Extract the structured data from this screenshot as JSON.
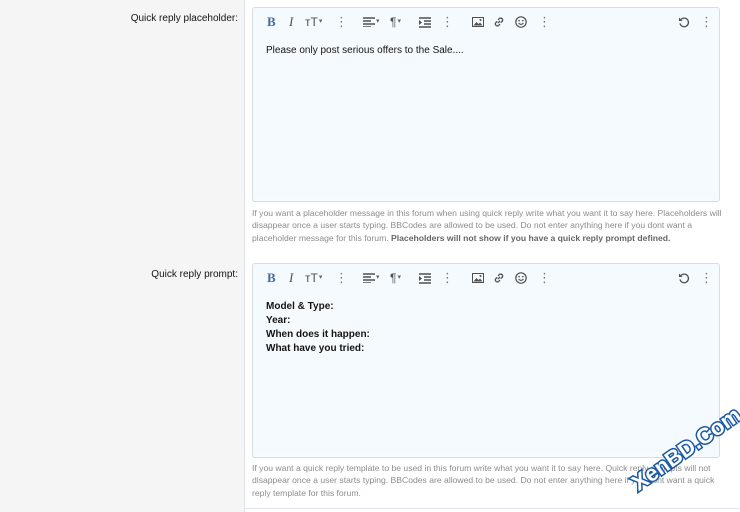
{
  "fields": [
    {
      "label": "Quick reply placeholder:",
      "content_lines": [
        "Please only post serious offers to the Sale...."
      ],
      "explain_text": "If you want a placeholder message in this forum when using quick reply write what you want it to say here. Placeholders will disappear once a user starts typing. BBCodes are allowed to be used. Do not enter anything here if you dont want a placeholder message for this forum.",
      "explain_strong": "Placeholders will not show if you have a quick reply prompt defined."
    },
    {
      "label": "Quick reply prompt:",
      "content_lines": [
        "Model & Type:",
        "Year:",
        "When does it happen:",
        "What have you tried:"
      ],
      "explain_text": "If you want a quick reply template to be used in this forum write what you want it to say here. Quick reply prompts will not disappear once a user starts typing. BBCodes are allowed to be used. Do not enter anything here if you dont want a quick reply template for this forum.",
      "explain_strong": ""
    }
  ],
  "toolbar": {
    "bold": "B",
    "italic": "I",
    "text_size": "тT",
    "caret": "▾",
    "more": "⋮",
    "paragraph": "¶",
    "icons": [
      "bold-icon",
      "italic-icon",
      "text-size-icon",
      "more-icon",
      "align-icon",
      "paragraph-icon",
      "indent-icon",
      "image-icon",
      "link-icon",
      "smilie-icon",
      "undo-icon"
    ]
  },
  "watermark": "XenBD.Com",
  "colors": {
    "editor_bg": "#f5fafe",
    "editor_border": "#d8dde3",
    "label_col_bg": "#f5f5f5",
    "bold_icon": "#3c6fa3",
    "watermark": "#1a5aa0"
  }
}
